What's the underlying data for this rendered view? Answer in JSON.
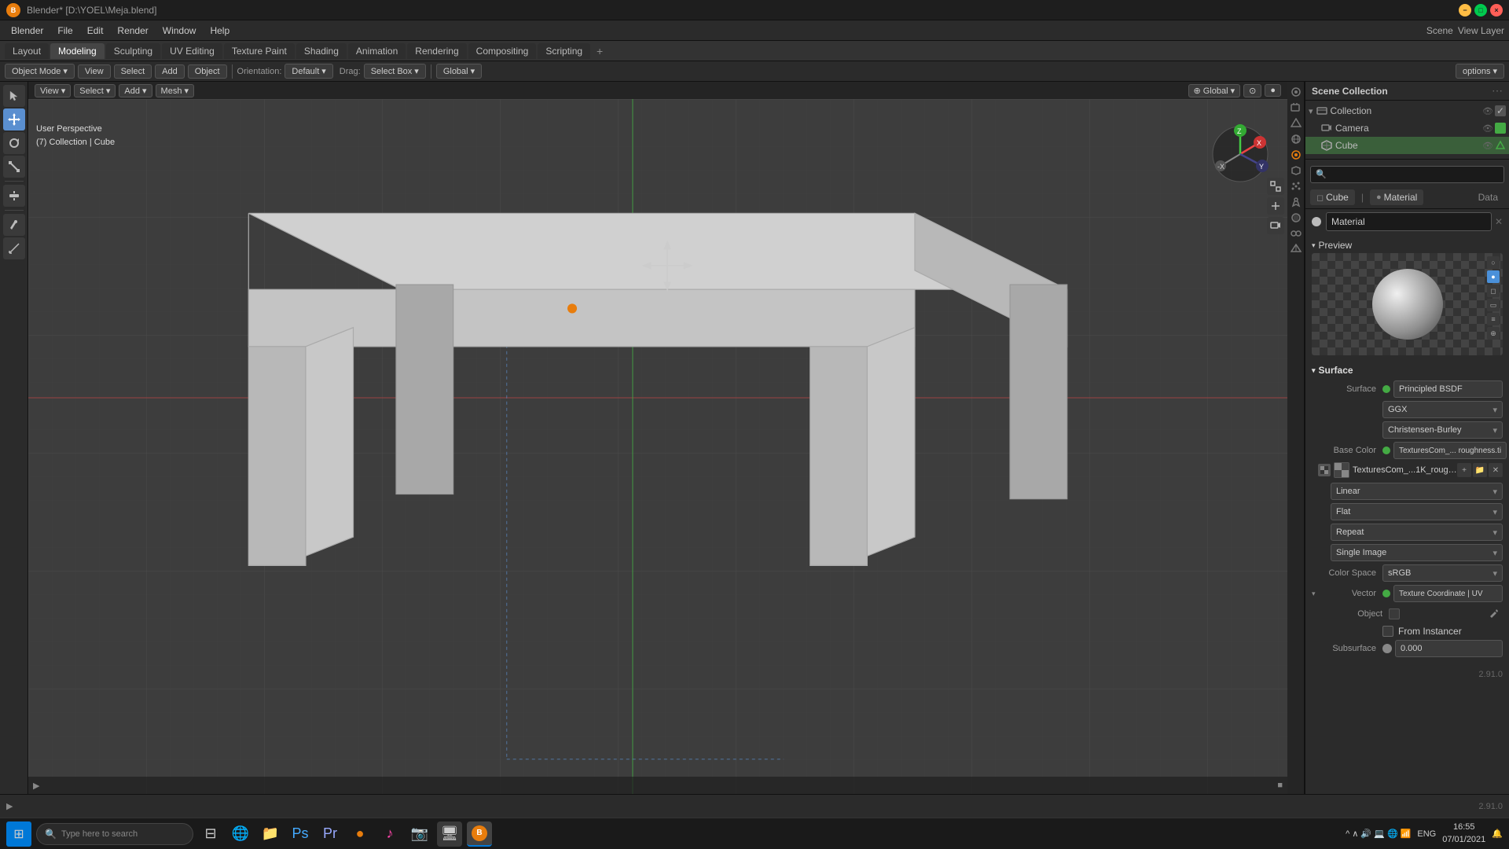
{
  "window": {
    "title": "Blender* [D:\\YOEL\\Meja.blend]",
    "version": "2.91.0"
  },
  "titlebar": {
    "app_name": "Blender* [D:\\YOEL\\Meja.blend]",
    "minimize": "−",
    "maximize": "□",
    "close": "×"
  },
  "menu": {
    "items": [
      "Blender",
      "File",
      "Edit",
      "Render",
      "Window",
      "Help"
    ]
  },
  "workspace_tabs": {
    "tabs": [
      "Layout",
      "Modeling",
      "Sculpting",
      "UV Editing",
      "Texture Paint",
      "Shading",
      "Animation",
      "Rendering",
      "Compositing",
      "Scripting"
    ],
    "active": "Modeling",
    "add": "+"
  },
  "toolbar": {
    "orientation_label": "Orientation:",
    "orientation_value": "Default",
    "drag_label": "Drag:",
    "select_box": "Select Box",
    "global_label": "Global",
    "options_label": "options",
    "view_label": "View",
    "select_label": "Select",
    "add_label": "Add",
    "object_label": "Object"
  },
  "mode_selector": {
    "value": "Object Mode"
  },
  "left_tools": {
    "tools": [
      "cursor",
      "move",
      "rotate",
      "scale",
      "transform",
      "annotate",
      "measure"
    ]
  },
  "viewport": {
    "info_line1": "User Perspective",
    "info_line2": "(7) Collection | Cube",
    "perspective": "User Perspective"
  },
  "scene_collection": {
    "title": "Scene Collection",
    "items": [
      {
        "name": "Collection",
        "type": "collection",
        "indent": 0
      },
      {
        "name": "Camera",
        "type": "camera",
        "indent": 1
      },
      {
        "name": "Cube",
        "type": "mesh",
        "indent": 1
      }
    ]
  },
  "properties": {
    "active_object": "Cube",
    "material_name": "Material",
    "surface_label": "Surface",
    "surface_shader": "Principled BSDF",
    "distribution": "GGX",
    "subsurface_method": "Christensen-Burley",
    "base_color_label": "Base Color",
    "base_color_value": "TexturesCom_... roughness.ti",
    "texture_name": "TexturesCom_...1K_roughness.tif",
    "interpolation": "Linear",
    "extension": "Flat",
    "repeat": "Repeat",
    "projection": "Single Image",
    "color_space_label": "Color Space",
    "color_space_value": "sRGB",
    "vector_label": "Vector",
    "vector_value": "Texture Coordinate | UV",
    "object_label": "Object",
    "from_instancer_label": "From Instancer",
    "subsurface_label": "Subsurface",
    "subsurface_value": "0.000",
    "preview_label": "Preview",
    "data_label": "Data",
    "material_tab_label": "Material",
    "cube_label": "Cube"
  },
  "status_bar": {
    "left": "",
    "center": "",
    "right": "2.91.0"
  },
  "taskbar": {
    "search_placeholder": "Type here to search",
    "time": "16:55",
    "date": "07/01/2021",
    "language": "ENG",
    "apps": [
      "⊞",
      "🔍",
      "🌐",
      "📁",
      "🎨",
      "🎞",
      "🔶",
      "🎵",
      "📷",
      "💻",
      "🔷"
    ]
  }
}
